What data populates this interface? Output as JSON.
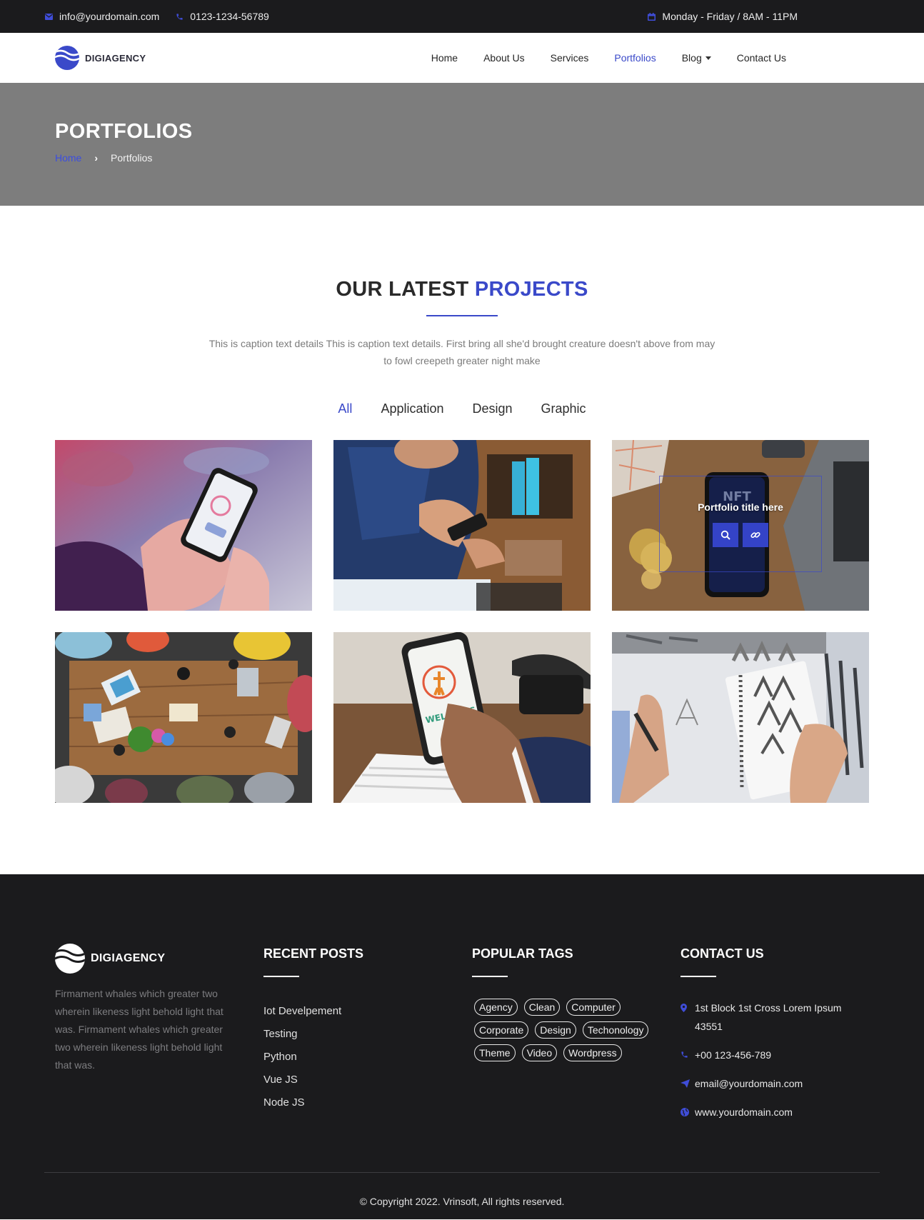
{
  "topbar": {
    "email": "info@yourdomain.com",
    "phone": "0123-1234-56789",
    "hours": "Monday - Friday / 8AM - 11PM",
    "icons": [
      "envelope-icon",
      "phone-icon",
      "calendar-icon"
    ]
  },
  "brand": {
    "name": "DIGIAGENCY",
    "accent_color": "#3a49c9"
  },
  "nav": {
    "items": [
      {
        "label": "Home"
      },
      {
        "label": "About Us"
      },
      {
        "label": "Services"
      },
      {
        "label": "Portfolios",
        "active": true
      },
      {
        "label": "Blog",
        "dropdown": true
      },
      {
        "label": "Contact Us"
      }
    ]
  },
  "page_header": {
    "title": "PORTFOLIOS",
    "breadcrumb": {
      "home": "Home",
      "separator": "›",
      "current": "Portfolios"
    }
  },
  "projects": {
    "title_main": "OUR LATEST",
    "title_accent": "PROJECTS",
    "caption": "This is caption text details This is caption text details. First bring all she'd brought creature doesn't above from may to fowl creepeth greater night make",
    "filters": [
      {
        "label": "All",
        "active": true
      },
      {
        "label": "Application"
      },
      {
        "label": "Design"
      },
      {
        "label": "Graphic"
      }
    ],
    "hover_overlay": {
      "title": "Portfolio title here",
      "buttons": [
        "search-icon",
        "link-icon"
      ]
    }
  },
  "footer": {
    "about": "Firmament whales which greater two wherein likeness light behold light that was. Firmament whales which greater two wherein likeness light behold light that was.",
    "recent_posts": {
      "title": "RECENT POSTS",
      "items": [
        "Iot Develpement",
        "Testing",
        "Python",
        "Vue JS",
        "Node JS"
      ]
    },
    "popular_tags": {
      "title": "POPULAR TAGS",
      "items": [
        "Agency",
        "Clean",
        "Computer",
        "Corporate",
        "Design",
        "Techonology",
        "Theme",
        "Video",
        "Wordpress"
      ]
    },
    "contact": {
      "title": "CONTACT US",
      "address": "1st Block 1st Cross Lorem Ipsum 43551",
      "phone": "+00 123-456-789",
      "email": "email@yourdomain.com",
      "website": "www.yourdomain.com"
    },
    "copyright": "© Copyright 2022. Vrinsoft, All rights reserved."
  }
}
